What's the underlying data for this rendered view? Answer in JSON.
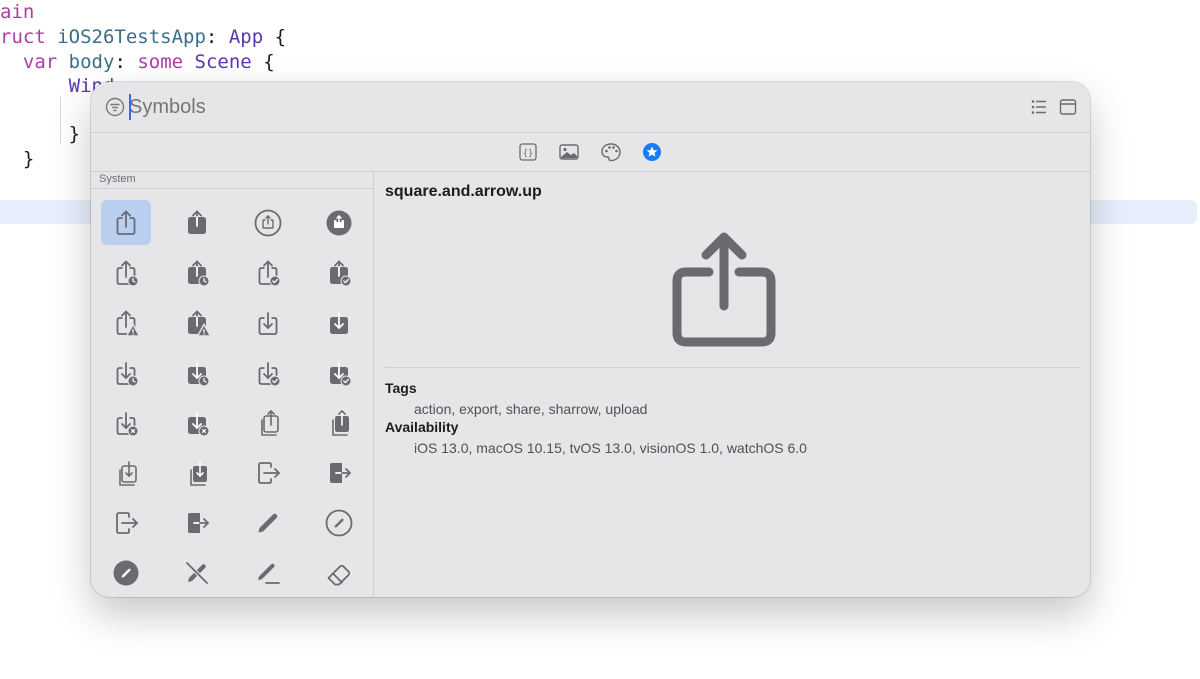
{
  "editor": {
    "lines": [
      {
        "parts": [
          {
            "t": "ain",
            "c": "kw"
          }
        ]
      },
      {
        "parts": [
          {
            "t": "ruct ",
            "c": "kw"
          },
          {
            "t": "iOS26TestsApp",
            "c": "tp"
          },
          {
            "t": ": ",
            "c": "plain"
          },
          {
            "t": "App",
            "c": "ty"
          },
          {
            "t": " {",
            "c": "plain"
          }
        ]
      },
      {
        "parts": [
          {
            "t": "  ",
            "c": "plain"
          },
          {
            "t": "var",
            "c": "kw"
          },
          {
            "t": " ",
            "c": "plain"
          },
          {
            "t": "body",
            "c": "tp"
          },
          {
            "t": ": ",
            "c": "plain"
          },
          {
            "t": "some",
            "c": "kw"
          },
          {
            "t": " ",
            "c": "plain"
          },
          {
            "t": "Scene",
            "c": "ty"
          },
          {
            "t": " {",
            "c": "plain"
          }
        ]
      },
      {
        "parts": [
          {
            "t": "      ",
            "c": "plain"
          },
          {
            "t": "Wind",
            "c": "ty"
          }
        ]
      },
      {
        "parts": [
          {
            "t": "",
            "c": "plain"
          }
        ]
      },
      {
        "parts": [
          {
            "t": "      }",
            "c": "plain"
          }
        ]
      },
      {
        "parts": [
          {
            "t": "  }",
            "c": "plain"
          }
        ]
      }
    ]
  },
  "search": {
    "placeholder": "Symbols",
    "value": ""
  },
  "toolbar": {
    "segments": [
      {
        "icon": "curlybraces-icon",
        "active": false
      },
      {
        "icon": "photo-icon",
        "active": false
      },
      {
        "icon": "palette-icon",
        "active": false
      },
      {
        "icon": "star-circle-fill-icon",
        "active": true
      }
    ],
    "accent": "#1a7cf4"
  },
  "sidebar": {
    "section_label": "System",
    "symbols": [
      "square.and.arrow.up",
      "square.and.arrow.up.fill",
      "square.and.arrow.up.circle",
      "square.and.arrow.up.circle.fill",
      "square.and.arrow.up.badge.clock",
      "square.and.arrow.up.badge.clock.fill",
      "square.and.arrow.up.badge.checkmark",
      "square.and.arrow.up.badge.checkmark.fill",
      "square.and.arrow.up.trianglebadge.exclamationmark",
      "square.and.arrow.up.trianglebadge.exclamationmark.fill",
      "square.and.arrow.down",
      "square.and.arrow.down.fill",
      "square.and.arrow.down.badge.clock",
      "square.and.arrow.down.badge.clock.fill",
      "square.and.arrow.down.badge.checkmark",
      "square.and.arrow.down.badge.checkmark.fill",
      "square.and.arrow.down.badge.xmark",
      "square.and.arrow.down.badge.xmark.fill",
      "square.and.arrow.up.on.square",
      "square.and.arrow.up.on.square.fill",
      "square.and.arrow.down.on.square",
      "square.and.arrow.down.on.square.fill",
      "rectangle.portrait.and.arrow.right",
      "rectangle.portrait.and.arrow.right.fill",
      "rectangle.portrait.and.arrow.forward",
      "rectangle.portrait.and.arrow.forward.fill",
      "pencil",
      "pencil.circle",
      "pencil.circle.fill",
      "pencil.slash",
      "pencil.line",
      "eraser"
    ],
    "selected_index": 0
  },
  "detail": {
    "name": "square.and.arrow.up",
    "tags_label": "Tags",
    "tags": "action, export, share, sharrow, upload",
    "availability_label": "Availability",
    "availability": "iOS 13.0, macOS 10.15, tvOS 13.0, visionOS 1.0, watchOS 6.0"
  },
  "colors": {
    "glyph": "#6b6b6f",
    "selection": "#b9cff0"
  }
}
